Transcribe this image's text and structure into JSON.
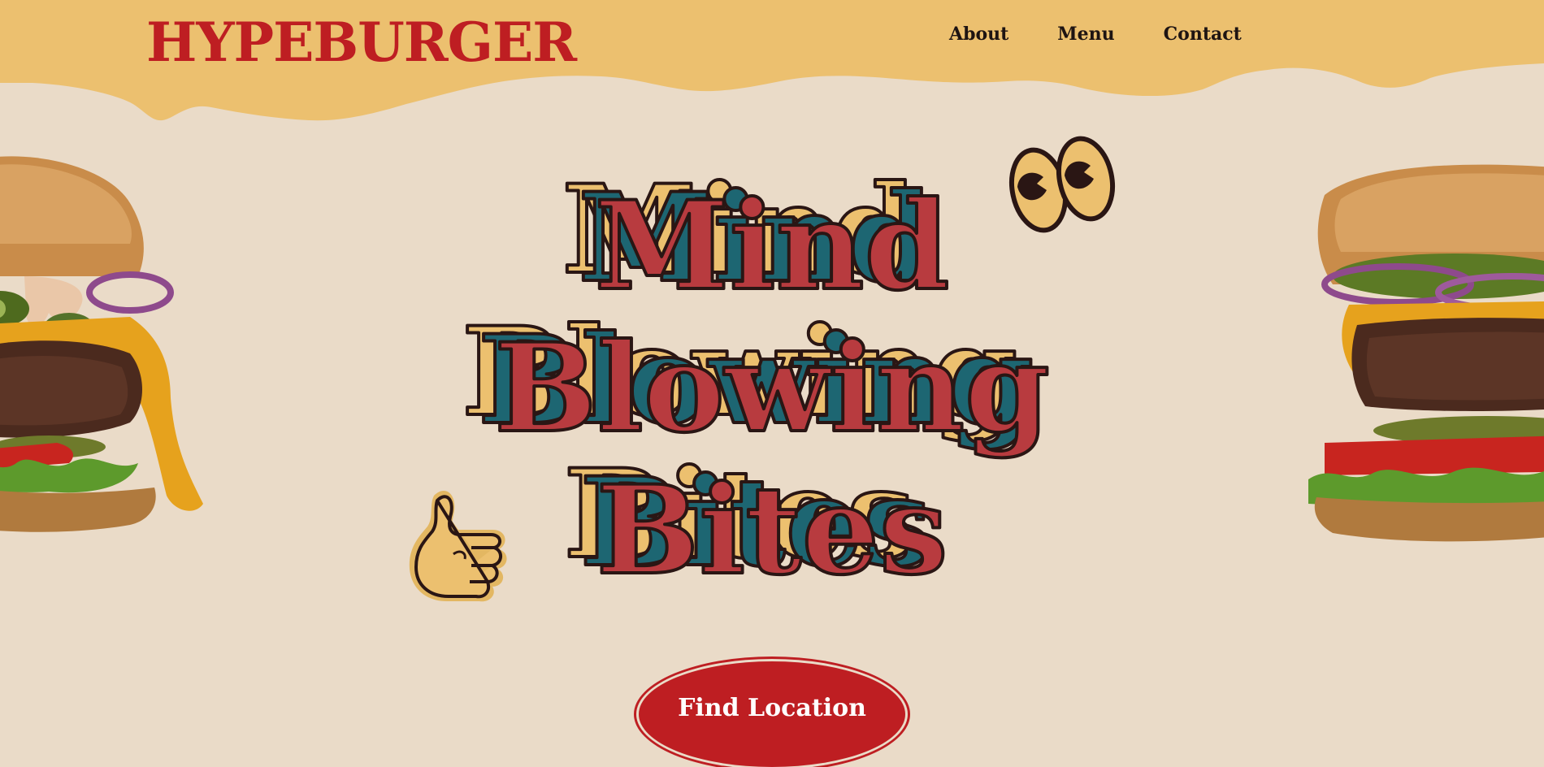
{
  "brand": {
    "name": "HYPEBURGER"
  },
  "nav": {
    "items": [
      {
        "label": "About"
      },
      {
        "label": "Menu"
      },
      {
        "label": "Contact"
      }
    ]
  },
  "hero": {
    "line1": "Mind",
    "line2": "Blowing",
    "line3": "Bites"
  },
  "cta": {
    "label": "Find Location"
  },
  "icons": {
    "eyes": "cartoon-eyes-icon",
    "thumb": "thumbs-up-icon"
  },
  "colors": {
    "page_bg": "#EADBC8",
    "header_bg": "#ECC06F",
    "brand_red": "#BE1E22",
    "headline_red": "#B83B3F",
    "shadow_teal": "#1D6672",
    "shadow_gold": "#ECC06F",
    "outline_dark": "#2A1614",
    "nav_text": "#1E1412"
  }
}
